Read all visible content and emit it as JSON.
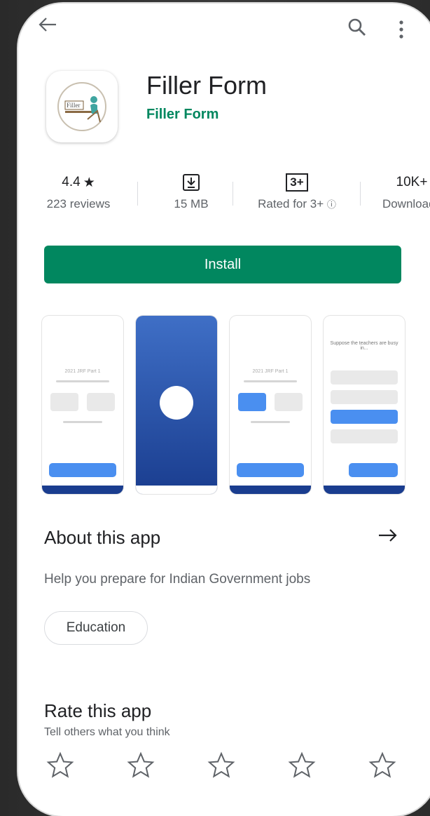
{
  "app": {
    "title": "Filler Form",
    "developer": "Filler Form",
    "icon_name": "filler-form-logo",
    "icon_text": "Filler"
  },
  "stats": {
    "rating": "4.4",
    "rating_icon": "star-icon",
    "reviews": "223 reviews",
    "size_icon": "download-icon",
    "size": "15 MB",
    "age_badge": "3+",
    "age_label": "Rated for 3+",
    "info_icon": "info-icon",
    "downloads": "10K+",
    "downloads_label": "Downloads"
  },
  "install_label": "Install",
  "screenshots": {
    "shot1_title": "2021 JRF Part 1",
    "shot3_title": "2021 JRF Part 1",
    "shot4_question": "Suppose the teachers are busy in..."
  },
  "about": {
    "title": "About this app",
    "description": "Help you prepare for Indian Government jobs",
    "category": "Education"
  },
  "rate": {
    "title": "Rate this app",
    "subtitle": "Tell others what you think",
    "stars": 5
  },
  "colors": {
    "accent": "#01875f",
    "text": "#202124",
    "secondary": "#5f6368",
    "screenshot_blue": "#1a3d8f"
  }
}
